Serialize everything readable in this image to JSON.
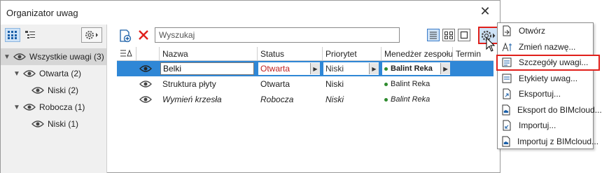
{
  "window": {
    "title": "Organizator uwag",
    "close_glyph": "✕"
  },
  "left_panel": {
    "tree": [
      {
        "label": "Wszystkie uwagi (3)",
        "level": 0,
        "expanded": true,
        "selected": true
      },
      {
        "label": "Otwarta (2)",
        "level": 1,
        "expanded": true
      },
      {
        "label": "Niski (2)",
        "level": 2
      },
      {
        "label": "Robocza (1)",
        "level": 1,
        "expanded": true
      },
      {
        "label": "Niski (1)",
        "level": 2
      }
    ]
  },
  "toolbar": {
    "search_placeholder": "Wyszukaj"
  },
  "table": {
    "columns": [
      "Nazwa",
      "Status",
      "Priorytet",
      "Menedżer zespołu",
      "Termin"
    ],
    "rows": [
      {
        "name": "Belki",
        "status": "Otwarta",
        "priority": "Niski",
        "manager": "Balint Reka",
        "italic": false,
        "selected": true
      },
      {
        "name": "Struktura płyty",
        "status": "Otwarta",
        "priority": "Niski",
        "manager": "Balint Reka",
        "italic": false,
        "selected": false
      },
      {
        "name": "Wymień krzesła",
        "status": "Robocza",
        "priority": "Niski",
        "manager": "Balint Reka",
        "italic": true,
        "selected": false
      }
    ]
  },
  "context_menu": {
    "items": [
      {
        "label": "Otwórz",
        "icon": "open-icon"
      },
      {
        "label": "Zmień nazwę...",
        "icon": "rename-icon"
      },
      {
        "label": "Szczegóły uwagi...",
        "icon": "details-icon",
        "highlighted": true
      },
      {
        "label": "Etykiety uwag...",
        "icon": "tags-icon"
      },
      {
        "label": "Eksportuj...",
        "icon": "export-icon"
      },
      {
        "label": "Eksport do BIMcloud...",
        "icon": "export-cloud-icon"
      },
      {
        "label": "Importuj...",
        "icon": "import-icon"
      },
      {
        "label": "Importuj z BIMcloud...",
        "icon": "import-cloud-icon"
      }
    ]
  },
  "colors": {
    "selection": "#2f87d6",
    "highlight_red": "#e0201b",
    "manager_dot": "#2e8b2e"
  }
}
